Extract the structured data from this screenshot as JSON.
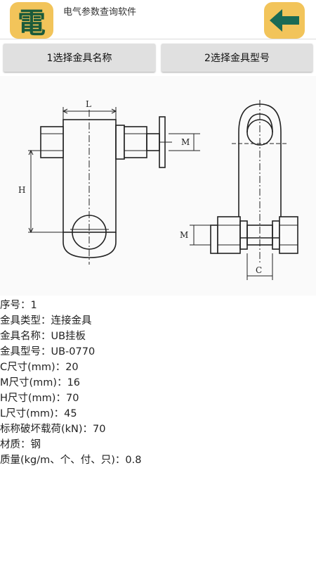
{
  "header": {
    "icon_glyph": "電",
    "title": "电气参数查询软件",
    "back_icon": "left-arrow-icon",
    "accent_color": "#f2c45a",
    "icon_text_color": "#1a5a3a",
    "arrow_color": "#1a6a55"
  },
  "tabs": [
    {
      "label": "1选择金具名称"
    },
    {
      "label": "2选择金具型号"
    }
  ],
  "drawing": {
    "labels": {
      "L": "L",
      "H": "H",
      "M_left": "M",
      "M_right": "M",
      "C": "C"
    }
  },
  "details": [
    "序号：1",
    "金具类型：连接金具",
    "金具名称：UB挂板",
    "金具型号：UB-0770",
    "C尺寸(mm)：20",
    "M尺寸(mm)：16",
    "H尺寸(mm)：70",
    "L尺寸(mm)：45",
    "标称破坏载荷(kN)：70",
    "材质：钢",
    "质量(kg/m、个、付、只)：0.8"
  ]
}
